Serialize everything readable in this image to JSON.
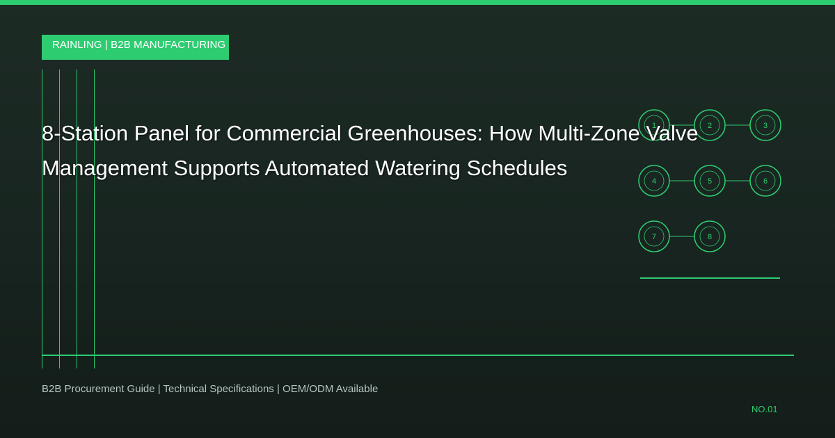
{
  "brand": {
    "label": "RAINLING | B2B MANUFACTURING"
  },
  "title": {
    "line1": "8-Station Panel for Commercial Greenhouses: How Multi-Zone Valve",
    "line2": "Management Supports Automated Watering Schedules"
  },
  "stations": [
    "1",
    "2",
    "3",
    "4",
    "5",
    "6",
    "7",
    "8"
  ],
  "footer": {
    "text": "B2B Procurement Guide | Technical Specifications | OEM/ODM Available"
  },
  "doc_number": "NO.01",
  "colors": {
    "accent": "#2ecc71",
    "background": "#1a2620",
    "title": "#ffffff",
    "footer_text": "#b8c4bf"
  }
}
